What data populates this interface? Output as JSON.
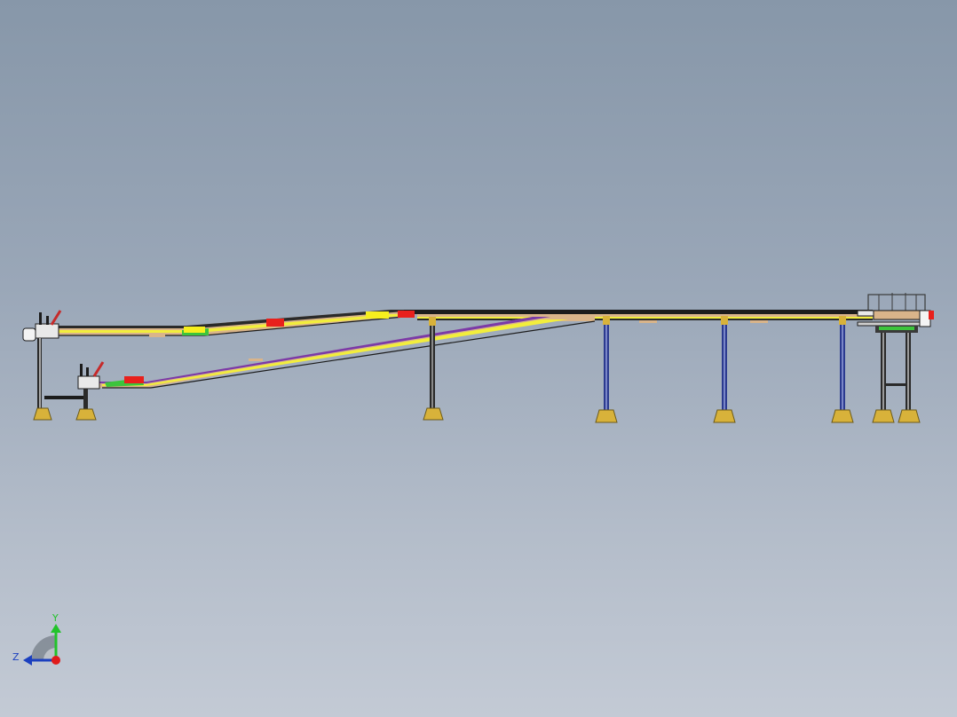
{
  "viewport": {
    "background_top": "#8797a9",
    "background_bottom": "#c3cad5"
  },
  "model": {
    "description_icon": "conveyor-cad-model-icon",
    "colors": {
      "frame_dark": "#1c1c1c",
      "belt_tan": "#d9b48a",
      "belt_yellow": "#f2ee3c",
      "belt_green": "#3cc43c",
      "belt_purple": "#7a3aa8",
      "block_red": "#e8201c",
      "block_yellow": "#f6ef1e",
      "leg_blue": "#2b3a8f",
      "foot_gold": "#d8b23a"
    }
  },
  "triad": {
    "x_label": "",
    "y_label": "Y",
    "z_label": "Z",
    "y_color": "#22c32a",
    "z_color": "#1b3fbf",
    "x_color": "#e01b1b"
  }
}
